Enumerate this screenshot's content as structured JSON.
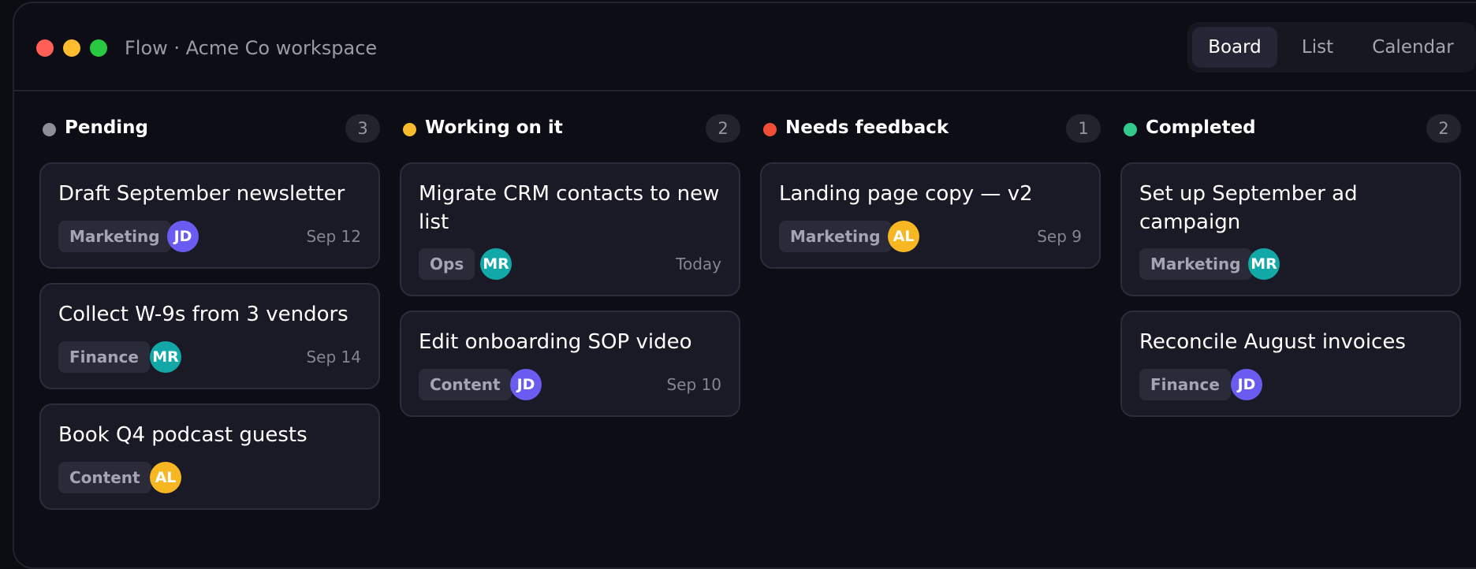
{
  "window": {
    "title": "Flow · Acme Co workspace"
  },
  "views": {
    "board": "Board",
    "list": "List",
    "calendar": "Calendar",
    "active": "Board"
  },
  "colors": {
    "pending": "#8e8e98",
    "working": "#f7bc2c",
    "feedback": "#f04e37",
    "completed": "#33c98a",
    "avatar_jd": "#6a5cf0",
    "avatar_mr": "#13a8a8",
    "avatar_al": "#f6b723"
  },
  "columns": [
    {
      "name": "Pending",
      "count": "3",
      "cards": [
        {
          "title": "Draft September newsletter",
          "tag": "Marketing",
          "avatar": "JD",
          "due": "Sep 12"
        },
        {
          "title": "Collect W-9s from 3 vendors",
          "tag": "Finance",
          "avatar": "MR",
          "due": "Sep 14"
        },
        {
          "title": "Book Q4 podcast guests",
          "tag": "Content",
          "avatar": "AL",
          "due": ""
        }
      ]
    },
    {
      "name": "Working on it",
      "count": "2",
      "cards": [
        {
          "title": "Migrate CRM contacts to new list",
          "tag": "Ops",
          "avatar": "MR",
          "due": "Today"
        },
        {
          "title": "Edit onboarding SOP video",
          "tag": "Content",
          "avatar": "JD",
          "due": "Sep 10"
        }
      ]
    },
    {
      "name": "Needs feedback",
      "count": "1",
      "cards": [
        {
          "title": "Landing page copy — v2",
          "tag": "Marketing",
          "avatar": "AL",
          "due": "Sep 9"
        }
      ]
    },
    {
      "name": "Completed",
      "count": "2",
      "cards": [
        {
          "title": "Set up September ad campaign",
          "tag": "Marketing",
          "avatar": "MR",
          "due": ""
        },
        {
          "title": "Reconcile August invoices",
          "tag": "Finance",
          "avatar": "JD",
          "due": ""
        }
      ]
    }
  ]
}
